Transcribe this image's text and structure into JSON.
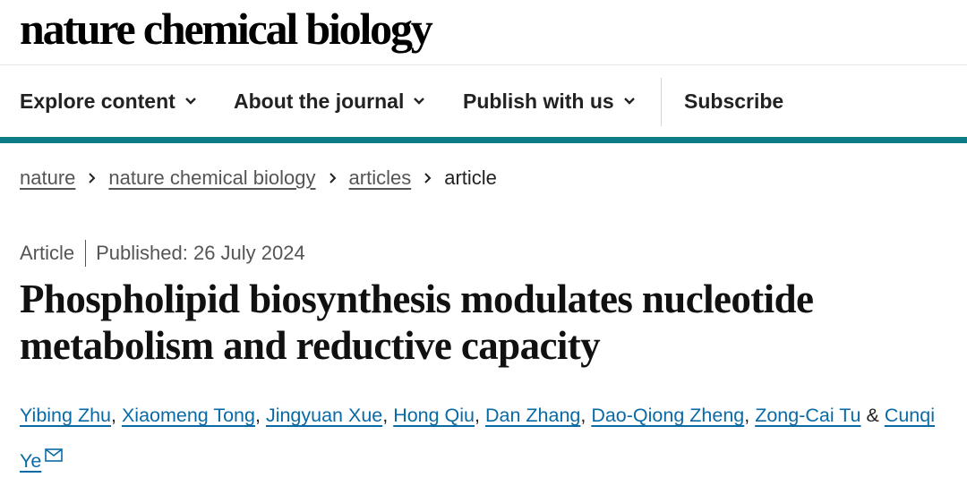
{
  "site": {
    "logo_text": "nature chemical biology"
  },
  "nav": {
    "items": [
      {
        "label": "Explore content",
        "icon": "chevron-down-icon"
      },
      {
        "label": "About the journal",
        "icon": "chevron-down-icon"
      },
      {
        "label": "Publish with us",
        "icon": "chevron-down-icon"
      },
      {
        "label": "Subscribe"
      }
    ]
  },
  "accent_color": "#0e7c86",
  "link_color": "#0a6aa6",
  "breadcrumb": {
    "items": [
      "nature",
      "nature chemical biology",
      "articles",
      "article"
    ],
    "separator_icon": "chevron-right-icon"
  },
  "article": {
    "type": "Article",
    "published": "Published: 26 July 2024",
    "title": "Phospholipid biosynthesis modulates nucleotide metabolism and reductive capacity",
    "authors": [
      "Yibing Zhu",
      "Xiaomeng Tong",
      "Jingyuan Xue",
      "Hong Qiu",
      "Dan Zhang",
      "Dao-Qiong Zheng",
      "Zong-Cai Tu",
      "Cunqi Ye"
    ],
    "author_separator": ", ",
    "author_last_separator": " &",
    "corresponding_icon": "mail-icon"
  }
}
